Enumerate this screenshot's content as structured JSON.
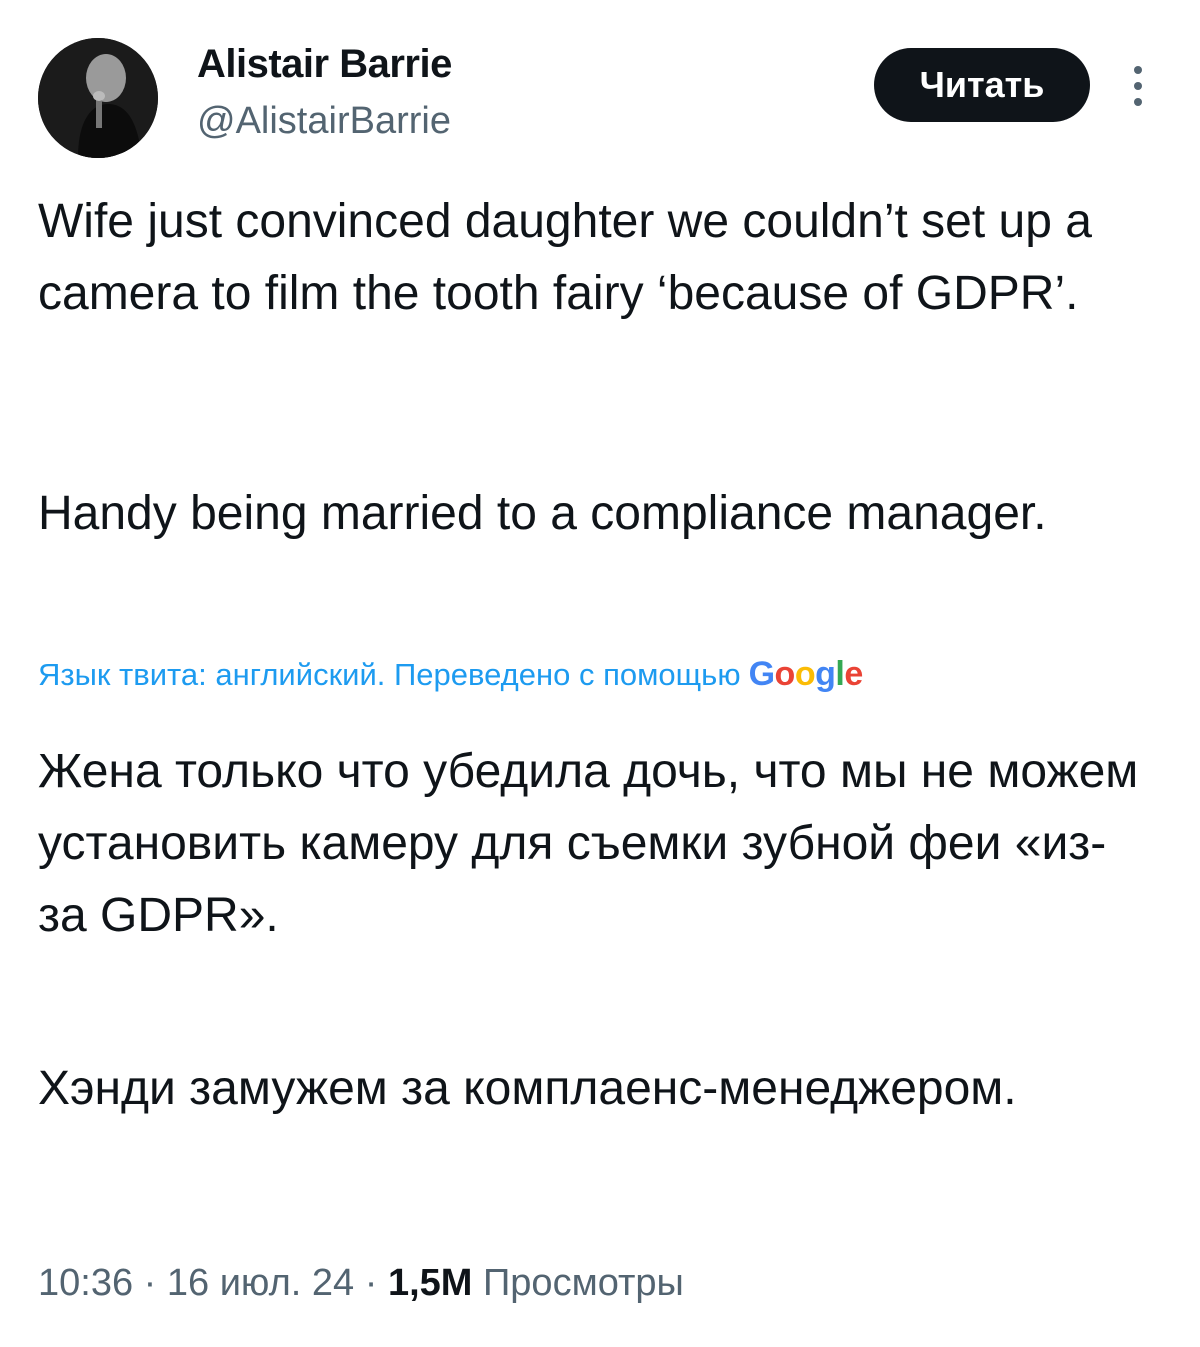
{
  "author": {
    "name": "Alistair Barrie",
    "handle": "@AlistairBarrie"
  },
  "follow_button_label": "Читать",
  "more_icon": "more-vertical-icon",
  "tweet": {
    "original_paragraphs": [
      "Wife just convinced daughter we couldn’t set up a camera to film the tooth fairy ‘because of GDPR’.",
      "Handy being married to a compliance manager."
    ],
    "translation_note": "Язык твита: английский. Переведено с помощью",
    "translation_provider": "Google",
    "translated_paragraphs": [
      "Жена только что убедила дочь, что мы не можем установить камеру для съемки зубной феи «из-за GDPR».",
      "Хэнди замужем за комплаенс-менеджером."
    ]
  },
  "meta": {
    "time": "10:36",
    "separator": "·",
    "date": "16 июл. 24",
    "views_count": "1,5M",
    "views_label": "Просмотры"
  },
  "colors": {
    "text": "#0f1419",
    "secondary": "#536471",
    "link": "#1d9bf0",
    "button_bg": "#0f1419"
  }
}
